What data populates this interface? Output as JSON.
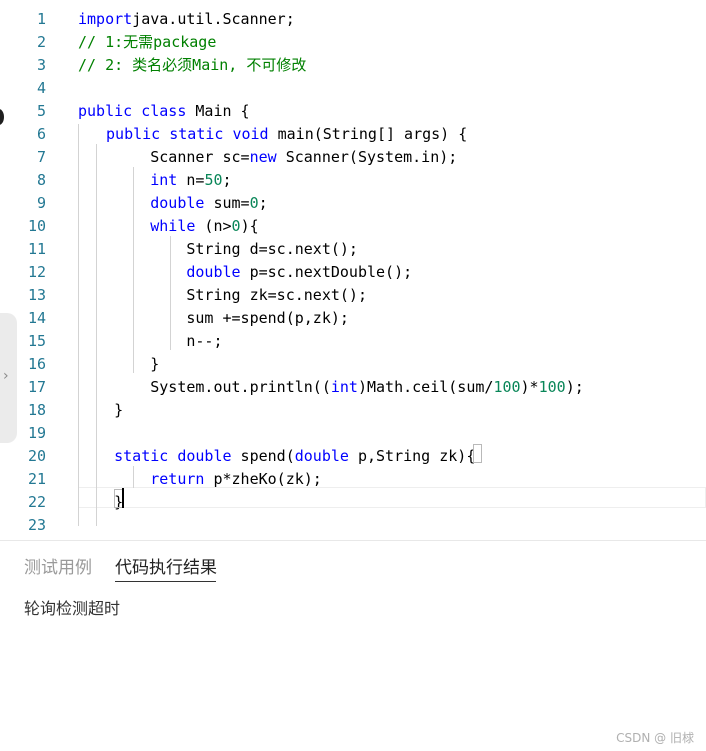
{
  "editor": {
    "lines": [
      {
        "n": "1",
        "tokens": [
          [
            "kw",
            "import"
          ],
          [
            "",
            "java.util.Scanner;"
          ]
        ]
      },
      {
        "n": "2",
        "tokens": [
          [
            "cm",
            "// 1:无需package"
          ]
        ]
      },
      {
        "n": "3",
        "tokens": [
          [
            "cm",
            "// 2: 类名必须Main, 不可修改"
          ]
        ]
      },
      {
        "n": "4",
        "tokens": []
      },
      {
        "n": "5",
        "tokens": [
          [
            "kw",
            "public"
          ],
          [
            "",
            " "
          ],
          [
            "kw",
            "class"
          ],
          [
            "",
            " Main {"
          ]
        ]
      },
      {
        "n": "6",
        "tokens": [
          [
            "",
            " "
          ],
          [
            "kw",
            "public"
          ],
          [
            "",
            " "
          ],
          [
            "kw",
            "static"
          ],
          [
            "",
            " "
          ],
          [
            "kw",
            "void"
          ],
          [
            "",
            " main(String[] args) {"
          ]
        ]
      },
      {
        "n": "7",
        "tokens": [
          [
            "",
            "        Scanner sc="
          ],
          [
            "kw",
            "new"
          ],
          [
            "",
            " Scanner(System.in);"
          ]
        ]
      },
      {
        "n": "8",
        "tokens": [
          [
            "",
            "        "
          ],
          [
            "kw",
            "int"
          ],
          [
            "",
            " n="
          ],
          [
            "num",
            "50"
          ],
          [
            "",
            ";"
          ]
        ]
      },
      {
        "n": "9",
        "tokens": [
          [
            "",
            "        "
          ],
          [
            "kw",
            "double"
          ],
          [
            "",
            " sum="
          ],
          [
            "num",
            "0"
          ],
          [
            "",
            ";"
          ]
        ]
      },
      {
        "n": "10",
        "tokens": [
          [
            "",
            "        "
          ],
          [
            "kw",
            "while"
          ],
          [
            "",
            " (n>"
          ],
          [
            "num",
            "0"
          ],
          [
            "",
            "){"
          ]
        ]
      },
      {
        "n": "11",
        "tokens": [
          [
            "",
            "            String d=sc.next();"
          ]
        ]
      },
      {
        "n": "12",
        "tokens": [
          [
            "",
            "            "
          ],
          [
            "kw",
            "double"
          ],
          [
            "",
            " p=sc.nextDouble();"
          ]
        ]
      },
      {
        "n": "13",
        "tokens": [
          [
            "",
            "            String zk=sc.next();"
          ]
        ]
      },
      {
        "n": "14",
        "tokens": [
          [
            "",
            "            sum +=spend(p,zk);"
          ]
        ]
      },
      {
        "n": "15",
        "tokens": [
          [
            "",
            "            n--;"
          ]
        ]
      },
      {
        "n": "16",
        "tokens": [
          [
            "",
            "        }"
          ]
        ]
      },
      {
        "n": "17",
        "tokens": [
          [
            "",
            "        System.out.println(("
          ],
          [
            "kw",
            "int"
          ],
          [
            "",
            ")Math.ceil(sum/"
          ],
          [
            "num",
            "100"
          ],
          [
            "",
            ")*"
          ],
          [
            "num",
            "100"
          ],
          [
            "",
            ");"
          ]
        ]
      },
      {
        "n": "18",
        "tokens": [
          [
            "",
            "    }"
          ]
        ]
      },
      {
        "n": "19",
        "tokens": []
      },
      {
        "n": "20",
        "tokens": [
          [
            "",
            "    "
          ],
          [
            "kw",
            "static"
          ],
          [
            "",
            " "
          ],
          [
            "kw",
            "double"
          ],
          [
            "",
            " spend("
          ],
          [
            "kw",
            "double"
          ],
          [
            "",
            " p,String zk){"
          ]
        ]
      },
      {
        "n": "21",
        "tokens": [
          [
            "",
            "        "
          ],
          [
            "kw",
            "return"
          ],
          [
            "",
            " p*zheKo(zk);"
          ]
        ]
      },
      {
        "n": "22",
        "tokens": [
          [
            "",
            "    }"
          ]
        ]
      },
      {
        "n": "23",
        "tokens": []
      }
    ]
  },
  "tabs": {
    "tests": "测试用例",
    "result": "代码执行结果"
  },
  "result": {
    "message": "轮询检测超时"
  },
  "watermark": "CSDN @ 旧梂",
  "colors": {
    "keyword": "#0000ff",
    "comment": "#008000",
    "number": "#098658",
    "line_number": "#237893"
  }
}
